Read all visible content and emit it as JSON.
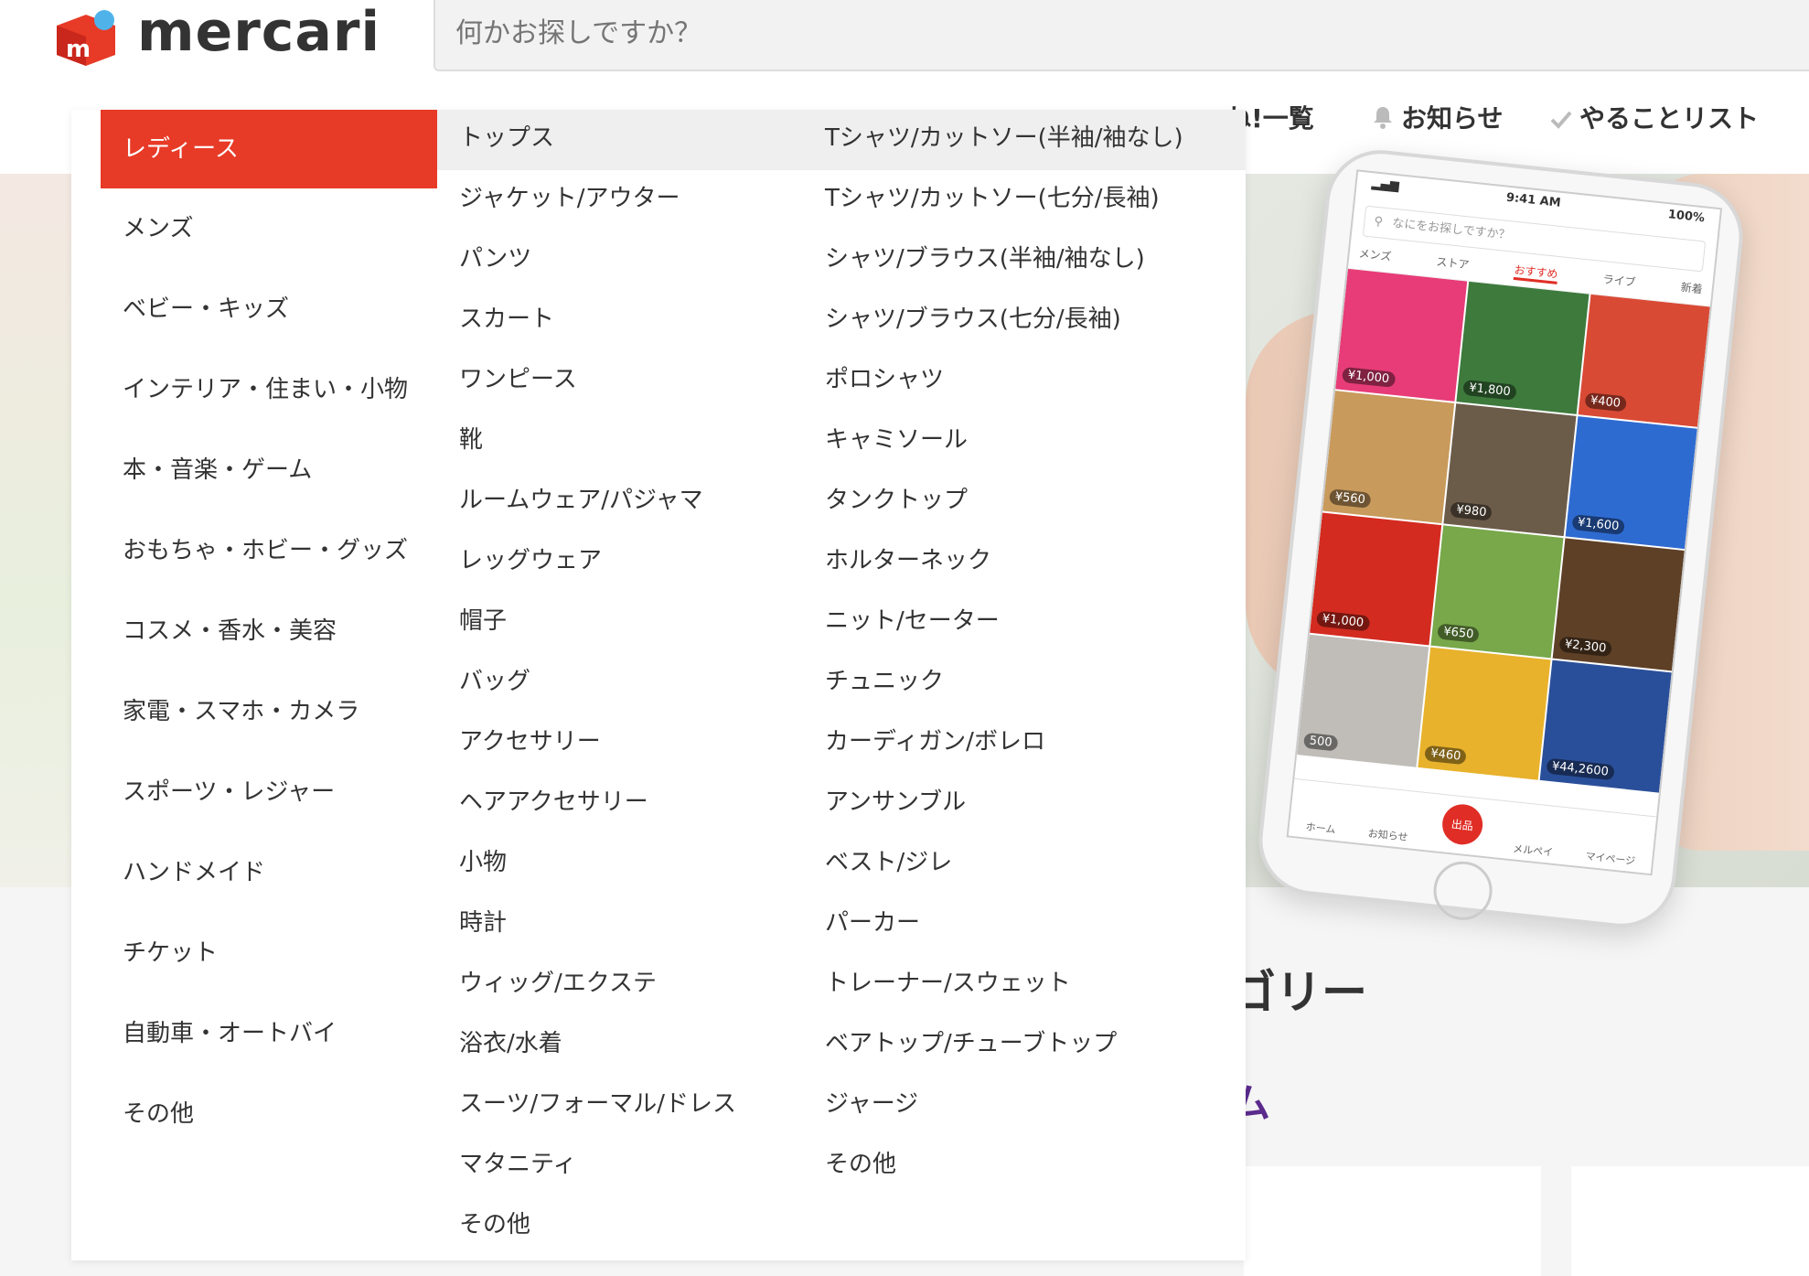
{
  "header": {
    "logo_text": "mercari",
    "search_placeholder": "何かお探しですか？",
    "nav": {
      "likes_label": "ね!一覧",
      "notifications_label": "お知らせ",
      "todo_label": "やることリスト"
    }
  },
  "menu": {
    "categories": [
      "レディース",
      "メンズ",
      "ベビー・キッズ",
      "インテリア・住まい・小物",
      "本・音楽・ゲーム",
      "おもちゃ・ホビー・グッズ",
      "コスメ・香水・美容",
      "家電・スマホ・カメラ",
      "スポーツ・レジャー",
      "ハンドメイド",
      "チケット",
      "自動車・オートバイ",
      "その他"
    ],
    "subcategories": [
      "トップス",
      "ジャケット/アウター",
      "パンツ",
      "スカート",
      "ワンピース",
      "靴",
      "ルームウェア/パジャマ",
      "レッグウェア",
      "帽子",
      "バッグ",
      "アクセサリー",
      "ヘアアクセサリー",
      "小物",
      "時計",
      "ウィッグ/エクステ",
      "浴衣/水着",
      "スーツ/フォーマル/ドレス",
      "マタニティ",
      "その他"
    ],
    "items": [
      "Tシャツ/カットソー(半袖/袖なし)",
      "Tシャツ/カットソー(七分/長袖)",
      "シャツ/ブラウス(半袖/袖なし)",
      "シャツ/ブラウス(七分/長袖)",
      "ポロシャツ",
      "キャミソール",
      "タンクトップ",
      "ホルターネック",
      "ニット/セーター",
      "チュニック",
      "カーディガン/ボレロ",
      "アンサンブル",
      "ベスト/ジレ",
      "パーカー",
      "トレーナー/スウェット",
      "ベアトップ/チューブトップ",
      "ジャージ",
      "その他"
    ]
  },
  "phone": {
    "time": "9:41 AM",
    "battery": "100%",
    "search_placeholder": "なにをお探しですか？",
    "tabs": [
      "メンズ",
      "ストア",
      "おすすめ",
      "ライブ",
      "新着"
    ],
    "prices": [
      "¥1,000",
      "¥1,800",
      "¥400",
      "¥560",
      "¥980",
      "¥1,600",
      "¥1,000",
      "¥650",
      "¥2,300",
      "500",
      "¥460",
      "¥44,2600"
    ],
    "bottom_nav": [
      "ホーム",
      "お知らせ",
      "出品",
      "メルペイ",
      "マイページ"
    ]
  },
  "background": {
    "section_heading": "ゴリー",
    "section_sub": "ム"
  },
  "colors": {
    "accent": "#e73a27",
    "purple": "#5a2a8c"
  }
}
